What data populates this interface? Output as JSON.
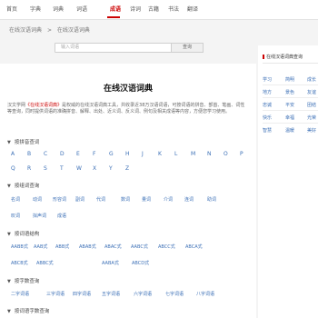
{
  "topnav": {
    "items": [
      {
        "label": "首页"
      },
      {
        "label": "字典"
      },
      {
        "label": "词典"
      },
      {
        "label": "词语"
      },
      {
        "label": "成语"
      },
      {
        "label": "诗词"
      },
      {
        "label": "古籍"
      },
      {
        "label": "书法"
      },
      {
        "label": "翻译"
      }
    ],
    "active_index": 4
  },
  "breadcrumb": {
    "items": [
      "在线汉语词典",
      ">",
      "在线汉语词典"
    ]
  },
  "search": {
    "placeholder": "输入词语",
    "button": "查询"
  },
  "page": {
    "title": "在线汉语词典",
    "intro_prefix": "汉文学网",
    "intro_highlight": "《在线汉语词典》",
    "intro_text": "是权威的在线汉语词典工具，共收录近38万汉语词语，可按词语的拼音、部首、笔画、词性等查询，同时提供词语的准确拼音、解释、出处、近义词、反义词、例句及相关成语等内容，方便您学习使用。"
  },
  "sections": {
    "pinyin": {
      "heading": "按拼音查词",
      "letters": [
        "A",
        "B",
        "C",
        "D",
        "E",
        "F",
        "G",
        "H",
        "J",
        "K",
        "L",
        "M",
        "N",
        "O",
        "P",
        "Q",
        "R",
        "S",
        "T",
        "W",
        "X",
        "Y",
        "Z"
      ]
    },
    "structure": {
      "heading": "按组词查询",
      "tags": [
        "名词",
        "动词",
        "形容词",
        "副词",
        "代词",
        "数词",
        "量词",
        "介词",
        "连词",
        "助词",
        "叹词",
        "拟声词",
        "成语"
      ]
    },
    "form": {
      "heading": "按词语结构",
      "tags": [
        "AABB式",
        "AAB式",
        "ABB式",
        "ABAB式",
        "ABAC式",
        "AABC式",
        "ABCC式",
        "ABCA式",
        "ABCB式",
        "ABBC式",
        "AABA式",
        "ABCD式"
      ]
    },
    "count": {
      "heading": "按字数查询",
      "tags": [
        "二字词语",
        "三字词语",
        "四字词语",
        "五字词语",
        "六字词语",
        "七字词语",
        "八字词语"
      ]
    },
    "more": {
      "heading": "按词语字数查询"
    }
  },
  "sidebar": {
    "title": "在线汉语词典查询",
    "links": [
      [
        "学习",
        "简明",
        "成长"
      ],
      [
        "地方",
        "景色",
        "友谊"
      ],
      [
        "忠诚",
        "平安",
        "团结"
      ],
      [
        "快乐",
        "幸福",
        "光荣"
      ],
      [
        "智慧",
        "温暖",
        "美好"
      ]
    ]
  }
}
